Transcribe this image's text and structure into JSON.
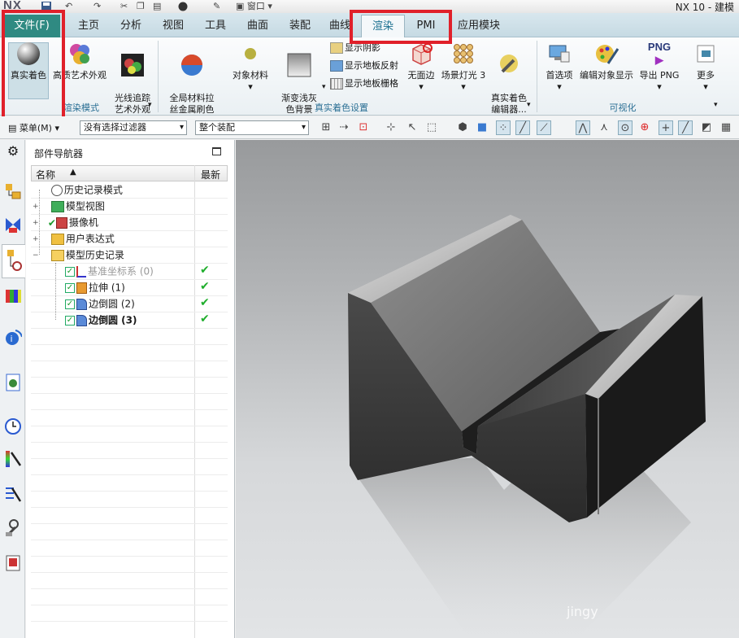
{
  "window": {
    "logo": "NX",
    "title": "NX 10 - 建模",
    "quick_access_window": "窗口"
  },
  "menu_tabs": [
    {
      "label": "文件(F)"
    },
    {
      "label": "主页"
    },
    {
      "label": "分析"
    },
    {
      "label": "视图"
    },
    {
      "label": "工具"
    },
    {
      "label": "曲面"
    },
    {
      "label": "装配"
    },
    {
      "label": "曲线"
    },
    {
      "label": "渲染"
    },
    {
      "label": "PMI"
    },
    {
      "label": "应用模块"
    }
  ],
  "ribbon": {
    "render_mode": {
      "label": "渲染模式",
      "buttons": [
        {
          "label": "真实着色"
        },
        {
          "label": "高质艺术外观"
        },
        {
          "label": "光线追踪\n艺术外观"
        }
      ]
    },
    "true_shading": {
      "label": "真实着色设置",
      "buttons": [
        {
          "label": "全局材料拉\n丝金属刷色"
        },
        {
          "label": "对象材料"
        },
        {
          "label": "渐变浅灰\n色背景"
        },
        {
          "label": "无面边"
        },
        {
          "label": "场景灯光 3"
        },
        {
          "label": "真实着色\n编辑器..."
        }
      ],
      "small": [
        {
          "label": "显示阴影"
        },
        {
          "label": "显示地板反射"
        },
        {
          "label": "显示地板栅格"
        }
      ]
    },
    "visualize": {
      "label": "可视化",
      "buttons": [
        {
          "label": "首选项"
        },
        {
          "label": "编辑对象显示"
        },
        {
          "label": "导出 PNG",
          "icon_text": "PNG"
        },
        {
          "label": "更多"
        }
      ]
    }
  },
  "toolbar": {
    "menu_label": "菜单(M)",
    "filter": "没有选择过滤器",
    "scope": "整个装配"
  },
  "navigator": {
    "title": "部件导航器",
    "col_name": "名称",
    "col_latest": "最新",
    "rows": [
      {
        "label": "历史记录模式"
      },
      {
        "label": "模型视图"
      },
      {
        "label": "摄像机"
      },
      {
        "label": "用户表达式"
      },
      {
        "label": "模型历史记录"
      },
      {
        "label": "基准坐标系 (0)"
      },
      {
        "label": "拉伸 (1)"
      },
      {
        "label": "边倒圆 (2)"
      },
      {
        "label": "边倒圆 (3)"
      }
    ]
  },
  "watermark": "jingy"
}
